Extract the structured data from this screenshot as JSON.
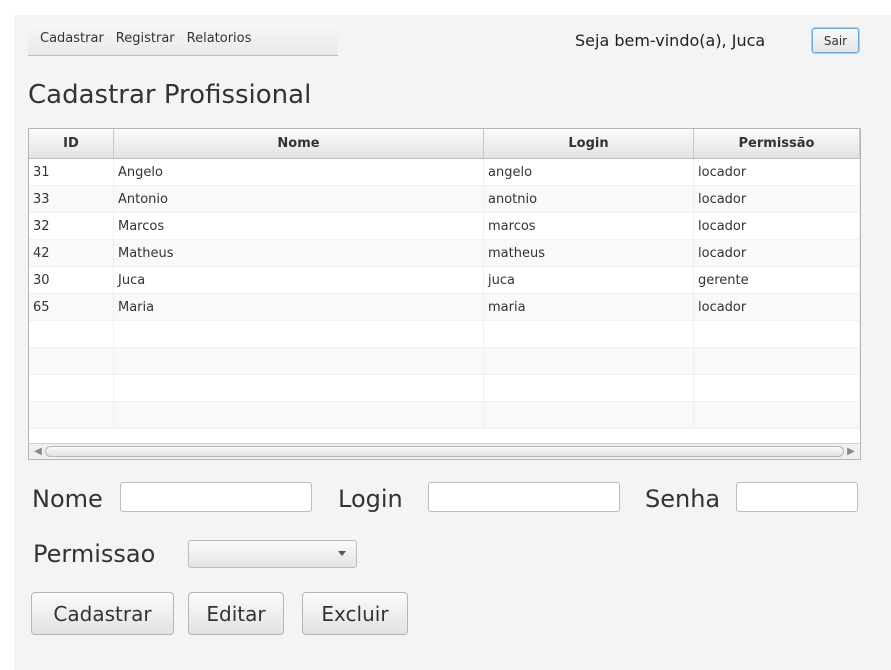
{
  "menu": {
    "items": [
      "Cadastrar",
      "Registrar",
      "Relatorios"
    ]
  },
  "header": {
    "welcome": "Seja bem-vindo(a), Juca",
    "logout_label": "Sair"
  },
  "page": {
    "title": "Cadastrar Profissional"
  },
  "table": {
    "columns": [
      "ID",
      "Nome",
      "Login",
      "Permissão"
    ],
    "rows": [
      [
        "31",
        "Angelo",
        "angelo",
        "locador"
      ],
      [
        "33",
        "Antonio",
        "anotnio",
        "locador"
      ],
      [
        "32",
        "Marcos",
        "marcos",
        "locador"
      ],
      [
        "42",
        "Matheus",
        "matheus",
        "locador"
      ],
      [
        "30",
        "Juca",
        "juca",
        "gerente"
      ],
      [
        "65",
        "Maria",
        "maria",
        "locador"
      ]
    ]
  },
  "form": {
    "nome_label": "Nome",
    "nome_value": "",
    "login_label": "Login",
    "login_value": "",
    "senha_label": "Senha",
    "senha_value": "",
    "permissao_label": "Permissao",
    "permissao_value": ""
  },
  "actions": {
    "cadastrar_label": "Cadastrar",
    "editar_label": "Editar",
    "excluir_label": "Excluir"
  }
}
